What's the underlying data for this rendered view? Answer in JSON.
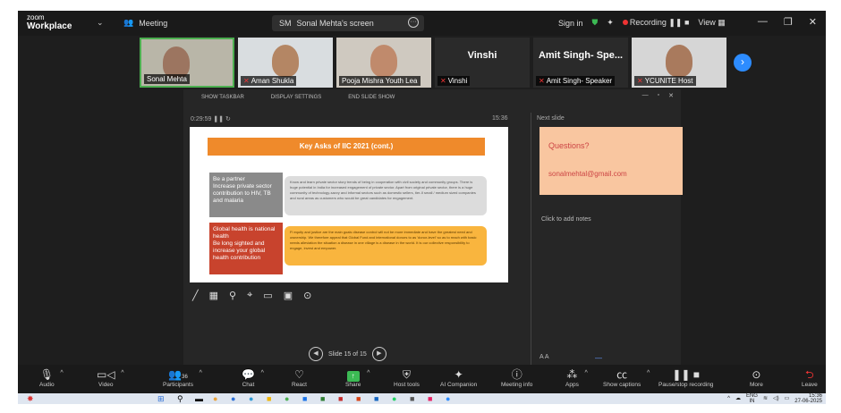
{
  "titlebar": {
    "logo_line1": "zoom",
    "logo_line2": "Workplace",
    "meeting_label": "Meeting",
    "screen_badge": "SM",
    "screen_title": "Sonal Mehta's screen",
    "signin": "Sign in",
    "recording": "Recording",
    "view": "View"
  },
  "participants": [
    {
      "name": "Sonal Mehta",
      "muted": false
    },
    {
      "name": "Aman Shukla",
      "muted": true
    },
    {
      "name": "Pooja Mishra Youth Lea",
      "muted": false
    },
    {
      "name": "Vinshi",
      "display": "Vinshi",
      "muted": true
    },
    {
      "name": "Amit Singh- Speaker",
      "display": "Amit Singh- Spe...",
      "muted": true
    },
    {
      "name": "YCUNITE Host",
      "muted": true
    }
  ],
  "presenter": {
    "toolbar": [
      "SHOW TASKBAR",
      "DISPLAY SETTINGS",
      "END SLIDE SHOW"
    ],
    "timer_left": "0:29:59",
    "timer_right": "15:36",
    "next_slide_label": "Next slide",
    "notes_placeholder": "Click to add notes",
    "slide_counter": "Slide 15 of 15",
    "font_size": "A A"
  },
  "slide": {
    "title": "Key Asks of IIC 2021 (cont.)",
    "grey_box": "Be a partner\nIncrease private sector contribution to HIV, TB and malaria",
    "grey_text": "Know and learn private sector story trends of being in cooperation with civil society and community groups. There is huge potential in India for increased engagement of private sector. Apart from original private sector, there is a huge community of technology-savvy and informal sectors such as domestic sellers, tier-II small / medium sized companies and rural areas as customers who would be great candidates for engagement.",
    "red_box": "Global health is national health\nBe long sighted and increase your global health contribution",
    "orange_text": "Fi equity and justice are the main goals disease control will not be more immediate and have the greatest need and ownership. We therefore appeal that Global Fund and international donors to as 'donor-level' so as to reach with basic needs alleviation the situation a disease in one village is a disease in the world. It is our collective responsibility to engage, invest and empower."
  },
  "next_slide": {
    "question": "Questions?",
    "email": "sonalmehtal@gmail.com"
  },
  "toolbar": {
    "audio": "Audio",
    "video": "Video",
    "participants": "Participants",
    "participants_count": "36",
    "chat": "Chat",
    "react": "React",
    "share": "Share",
    "host_tools": "Host tools",
    "ai": "AI Companion",
    "info": "Meeting info",
    "apps": "Apps",
    "captions": "Show captions",
    "pause_rec": "Pause/stop recording",
    "more": "More",
    "leave": "Leave"
  },
  "tray": {
    "lang1": "ENG",
    "lang2": "IN",
    "time": "15:36",
    "date": "27-06-2025"
  }
}
